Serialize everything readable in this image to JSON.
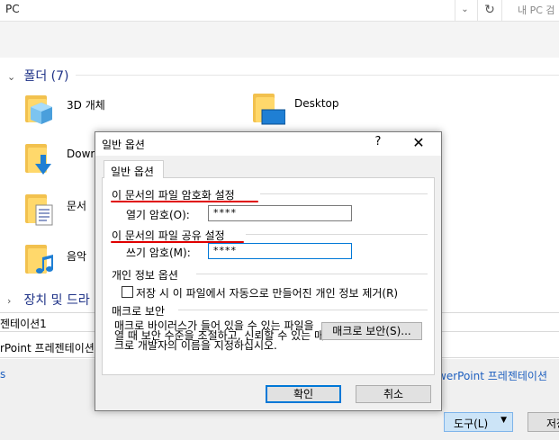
{
  "explorer": {
    "address_text": "PC",
    "search_placeholder": "내 PC 검",
    "folders_header": "폴더 (7)",
    "folders": [
      {
        "label": "3D 개체"
      },
      {
        "label": "Desktop"
      },
      {
        "label": "Down"
      },
      {
        "label": "문서"
      },
      {
        "label": "음악"
      }
    ],
    "devices_header": "장치 및 드라",
    "file_name_value": "젠테이션1",
    "file_type_value": "rPoint 프레젠테이션",
    "left_letter": "s",
    "file_type_right": "werPoint 프레젠테이션",
    "tools_button": "도구(L)",
    "save_button": "저장"
  },
  "dialog": {
    "title": "일반 옵션",
    "help_glyph": "?",
    "close_glyph": "✕",
    "tab_label": "일반 옵션",
    "encrypt_group": "이 문서의 파일 암호화 설정",
    "open_password_label": "열기 암호(O):",
    "open_password_value": "****",
    "share_group": "이 문서의 파일 공유 설정",
    "modify_password_label": "쓰기 암호(M):",
    "modify_password_value": "****",
    "privacy_group": "개인 정보 옵션",
    "remove_personal_info_label": "저장 시 이 파일에서 자동으로 만들어진 개인 정보 제거(R)",
    "remove_personal_info_checked": false,
    "macro_group": "매크로 보안",
    "macro_description": "매크로 바이러스가 들어 있을 수 있는 파일을 열 때 보안 수준을 조절하고, 신뢰할 수 있는 매크로 개발자의 이름을 지정하십시오.",
    "macro_security_button": "매크로 보안(S)...",
    "ok_button": "확인",
    "cancel_button": "취소"
  },
  "colors": {
    "annotation_red": "#e00000",
    "accent_blue": "#0078d7",
    "folder_yellow": "#ffd86b"
  }
}
